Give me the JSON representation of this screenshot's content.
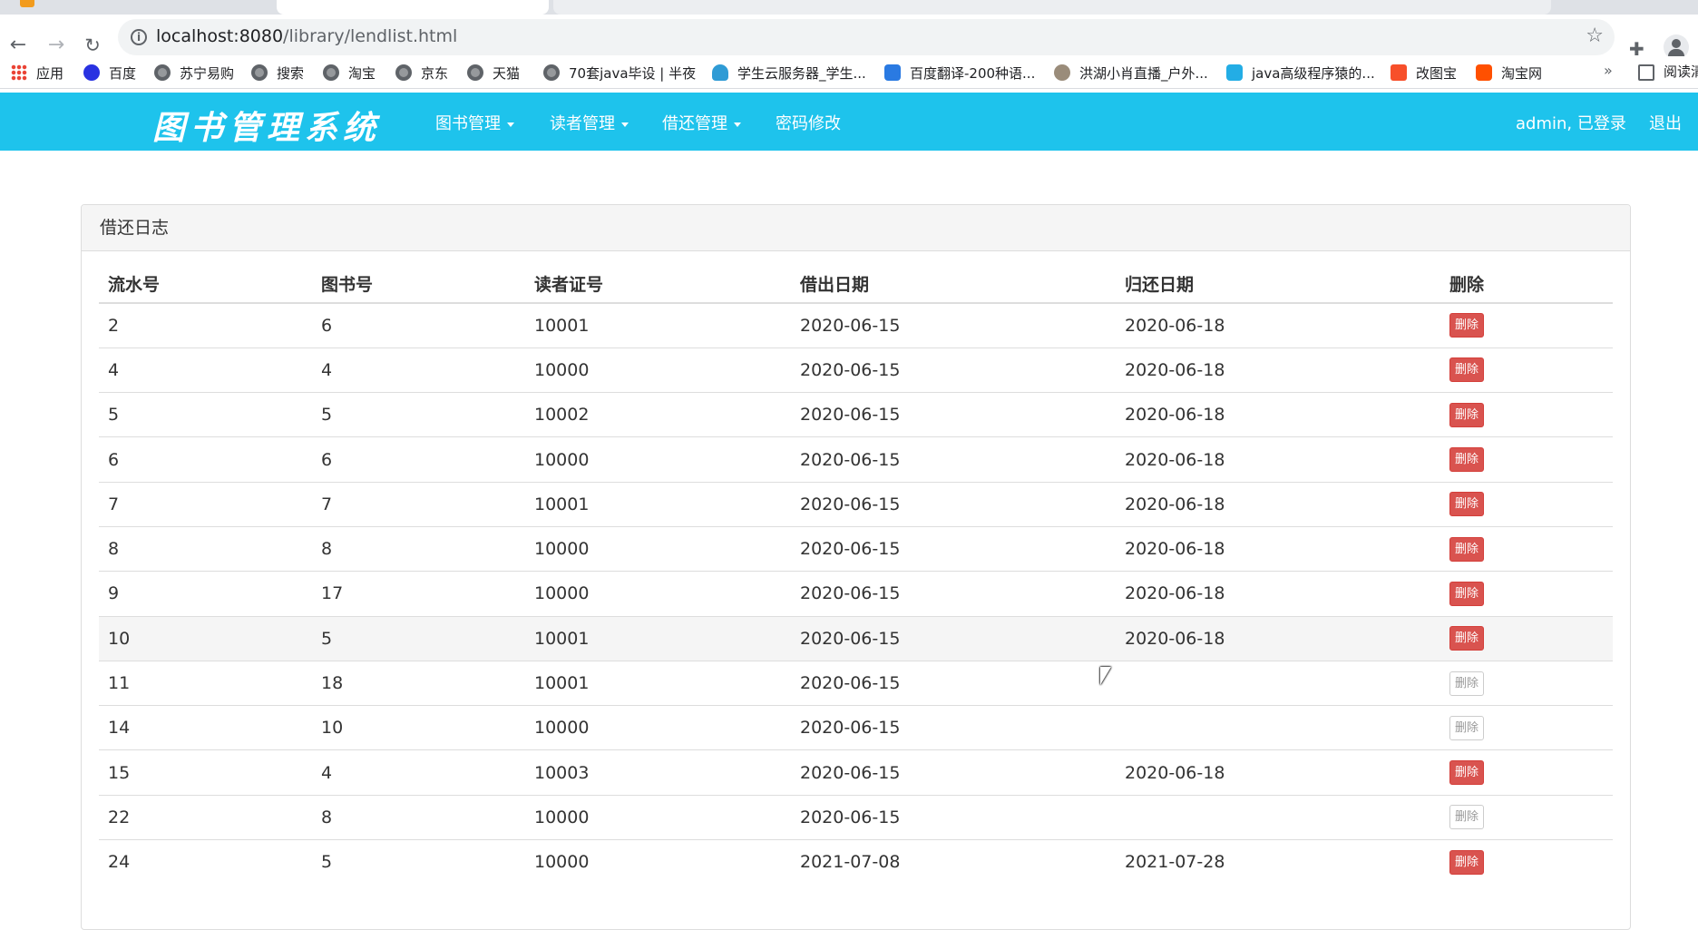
{
  "browser": {
    "url_host": "localhost:8080",
    "url_path": "/library/lendlist.html",
    "bookmarks": [
      {
        "label": "应用",
        "icon": "apps-grid-icon"
      },
      {
        "label": "百度",
        "icon": "baidu-paw-icon"
      },
      {
        "label": "苏宁易购",
        "icon": "globe-icon"
      },
      {
        "label": "搜索",
        "icon": "globe-icon"
      },
      {
        "label": "淘宝",
        "icon": "globe-icon"
      },
      {
        "label": "京东",
        "icon": "globe-icon"
      },
      {
        "label": "天猫",
        "icon": "globe-icon"
      },
      {
        "label": "70套java毕设 | 半夜",
        "icon": "globe-icon"
      },
      {
        "label": "学生云服务器_学生...",
        "icon": "cloud-icon"
      },
      {
        "label": "百度翻译-200种语...",
        "icon": "translate-icon"
      },
      {
        "label": "洪湖小肖直播_户外...",
        "icon": "avatar-icon"
      },
      {
        "label": "java高级程序猿的...",
        "icon": "bilibili-icon"
      },
      {
        "label": "改图宝",
        "icon": "gaitubao-icon"
      },
      {
        "label": "淘宝网",
        "icon": "taobao-icon"
      }
    ],
    "more_label": "»",
    "reader_label": "阅读清"
  },
  "navbar": {
    "brand": "图书管理系统",
    "menus": {
      "book": "图书管理",
      "reader": "读者管理",
      "lend": "借还管理",
      "password": "密码修改"
    },
    "user_status": "admin, 已登录",
    "logout": "退出"
  },
  "panel": {
    "title": "借还日志",
    "columns": {
      "serial": "流水号",
      "book": "图书号",
      "reader": "读者证号",
      "lend_date": "借出日期",
      "back_date": "归还日期",
      "delete": "删除"
    },
    "delete_label": "删除",
    "rows": [
      {
        "serial": "2",
        "book": "6",
        "reader": "10001",
        "lend_date": "2020-06-15",
        "back_date": "2020-06-18",
        "deletable": true
      },
      {
        "serial": "4",
        "book": "4",
        "reader": "10000",
        "lend_date": "2020-06-15",
        "back_date": "2020-06-18",
        "deletable": true
      },
      {
        "serial": "5",
        "book": "5",
        "reader": "10002",
        "lend_date": "2020-06-15",
        "back_date": "2020-06-18",
        "deletable": true
      },
      {
        "serial": "6",
        "book": "6",
        "reader": "10000",
        "lend_date": "2020-06-15",
        "back_date": "2020-06-18",
        "deletable": true
      },
      {
        "serial": "7",
        "book": "7",
        "reader": "10001",
        "lend_date": "2020-06-15",
        "back_date": "2020-06-18",
        "deletable": true
      },
      {
        "serial": "8",
        "book": "8",
        "reader": "10000",
        "lend_date": "2020-06-15",
        "back_date": "2020-06-18",
        "deletable": true
      },
      {
        "serial": "9",
        "book": "17",
        "reader": "10000",
        "lend_date": "2020-06-15",
        "back_date": "2020-06-18",
        "deletable": true
      },
      {
        "serial": "10",
        "book": "5",
        "reader": "10001",
        "lend_date": "2020-06-15",
        "back_date": "2020-06-18",
        "deletable": true,
        "hover": true
      },
      {
        "serial": "11",
        "book": "18",
        "reader": "10001",
        "lend_date": "2020-06-15",
        "back_date": "",
        "deletable": false
      },
      {
        "serial": "14",
        "book": "10",
        "reader": "10000",
        "lend_date": "2020-06-15",
        "back_date": "",
        "deletable": false
      },
      {
        "serial": "15",
        "book": "4",
        "reader": "10003",
        "lend_date": "2020-06-15",
        "back_date": "2020-06-18",
        "deletable": true
      },
      {
        "serial": "22",
        "book": "8",
        "reader": "10000",
        "lend_date": "2020-06-15",
        "back_date": "",
        "deletable": false
      },
      {
        "serial": "24",
        "book": "5",
        "reader": "10000",
        "lend_date": "2021-07-08",
        "back_date": "2021-07-28",
        "deletable": true
      }
    ]
  },
  "colors": {
    "navbar_bg": "#1ec3ec",
    "delete_enabled": "#d9534f",
    "delete_disabled_text": "#999999"
  }
}
